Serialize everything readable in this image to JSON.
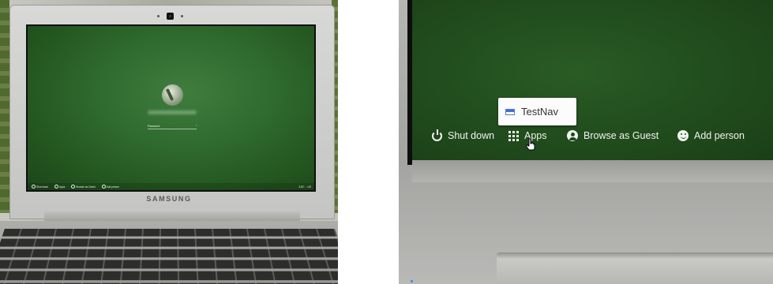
{
  "left_photo": {
    "brand": "SAMSUNG",
    "password_placeholder": "Password",
    "shelf": {
      "shutdown": "Shut down",
      "apps": "Apps",
      "browse_guest": "Browse as Guest",
      "add_person": "Add person",
      "tray": "3:52 ◦ ◦ US"
    }
  },
  "right_photo": {
    "popup_app": "TestNav",
    "shelf": {
      "shutdown": "Shut down",
      "apps": "Apps",
      "browse_guest": "Browse as Guest",
      "add_person": "Add person"
    }
  },
  "colors": {
    "screen_green": "#2a5b25",
    "shelf_text": "#f1f4ee",
    "popup_bg": "#fbfcfb",
    "testnav_icon": "#3f6fd6"
  },
  "icons": [
    "power-icon",
    "apps-grid-icon",
    "guest-icon",
    "add-person-icon",
    "testnav-icon",
    "hand-cursor-icon",
    "webcam-icon",
    "avatar-icon"
  ]
}
